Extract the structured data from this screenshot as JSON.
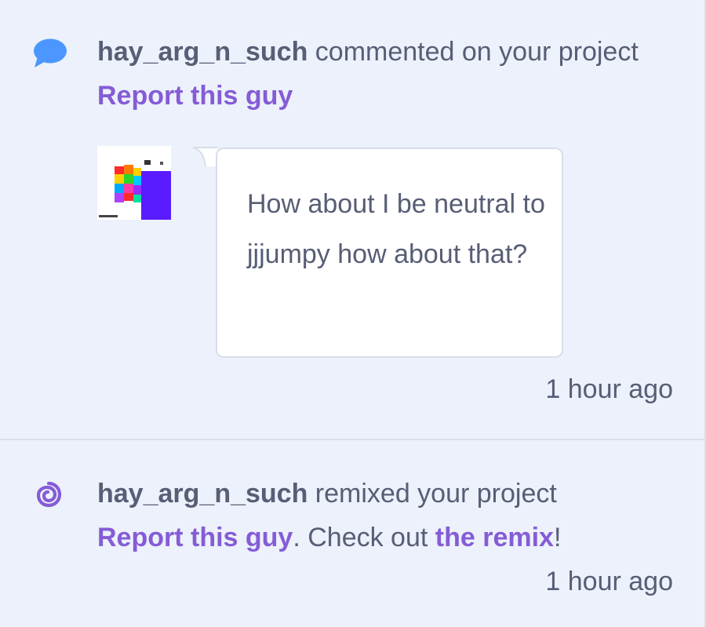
{
  "notifications": [
    {
      "icon": "comment-icon",
      "username": "hay_arg_n_such",
      "action": " commented on your project",
      "report_label": "Report this guy",
      "comment_text": "How about I be neutral to jjjumpy how about that?",
      "time": "1 hour ago"
    },
    {
      "icon": "remix-icon",
      "username": "hay_arg_n_such",
      "action": " remixed your project",
      "report_label": "Report this guy",
      "check_out_text": ". Check out ",
      "remix_label": "the remix",
      "exclaim": "!",
      "time": "1 hour ago"
    }
  ],
  "colors": {
    "background": "#ecf1fb",
    "text": "#575e75",
    "link": "#855cd6",
    "comment_icon": "#4c97ff",
    "remix_icon": "#855cd6",
    "divider": "#d9dee8"
  }
}
